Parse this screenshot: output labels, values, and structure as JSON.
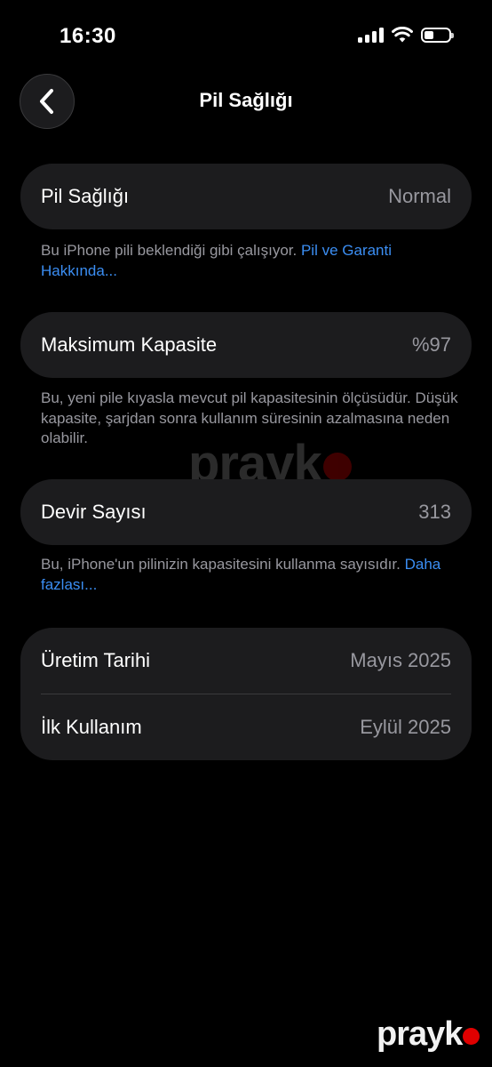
{
  "status_bar": {
    "time": "16:30"
  },
  "nav": {
    "title": "Pil Sağlığı"
  },
  "battery_health": {
    "label": "Pil Sağlığı",
    "value": "Normal",
    "footnote": "Bu iPhone pili beklendiği gibi çalışıyor.",
    "footnote_link": "Pil ve Garanti Hakkında..."
  },
  "max_capacity": {
    "label": "Maksimum Kapasite",
    "value": "%97",
    "footnote": "Bu, yeni pile kıyasla mevcut pil kapasitesinin ölçüsüdür. Düşük kapasite, şarjdan sonra kullanım süresinin azalmasına neden olabilir."
  },
  "cycle_count": {
    "label": "Devir Sayısı",
    "value": "313",
    "footnote": "Bu, iPhone'un pilinizin kapasitesini kullanma sayısıdır.",
    "footnote_link": "Daha fazlası..."
  },
  "dates": {
    "manufacture_label": "Üretim Tarihi",
    "manufacture_value": "Mayıs 2025",
    "first_use_label": "İlk Kullanım",
    "first_use_value": "Eylül 2025"
  },
  "watermark": {
    "text": "prayk"
  },
  "icons": {
    "back": "chevron-left-icon",
    "signal": "cellular-signal-icon",
    "wifi": "wifi-icon",
    "battery": "battery-icon"
  },
  "colors": {
    "accent": "#3b8ef3",
    "card": "#1c1c1e",
    "secondary_text": "#98989f"
  }
}
